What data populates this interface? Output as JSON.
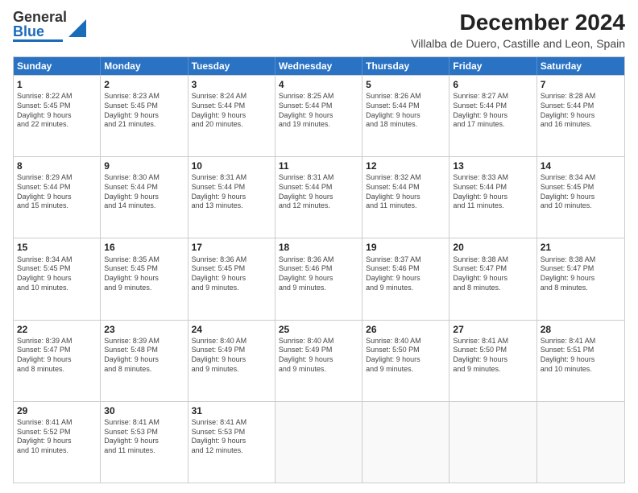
{
  "header": {
    "logo_general": "General",
    "logo_blue": "Blue",
    "title": "December 2024",
    "subtitle": "Villalba de Duero, Castille and Leon, Spain"
  },
  "days_of_week": [
    "Sunday",
    "Monday",
    "Tuesday",
    "Wednesday",
    "Thursday",
    "Friday",
    "Saturday"
  ],
  "weeks": [
    [
      {
        "day": "1",
        "lines": [
          "Sunrise: 8:22 AM",
          "Sunset: 5:45 PM",
          "Daylight: 9 hours",
          "and 22 minutes."
        ]
      },
      {
        "day": "2",
        "lines": [
          "Sunrise: 8:23 AM",
          "Sunset: 5:45 PM",
          "Daylight: 9 hours",
          "and 21 minutes."
        ]
      },
      {
        "day": "3",
        "lines": [
          "Sunrise: 8:24 AM",
          "Sunset: 5:44 PM",
          "Daylight: 9 hours",
          "and 20 minutes."
        ]
      },
      {
        "day": "4",
        "lines": [
          "Sunrise: 8:25 AM",
          "Sunset: 5:44 PM",
          "Daylight: 9 hours",
          "and 19 minutes."
        ]
      },
      {
        "day": "5",
        "lines": [
          "Sunrise: 8:26 AM",
          "Sunset: 5:44 PM",
          "Daylight: 9 hours",
          "and 18 minutes."
        ]
      },
      {
        "day": "6",
        "lines": [
          "Sunrise: 8:27 AM",
          "Sunset: 5:44 PM",
          "Daylight: 9 hours",
          "and 17 minutes."
        ]
      },
      {
        "day": "7",
        "lines": [
          "Sunrise: 8:28 AM",
          "Sunset: 5:44 PM",
          "Daylight: 9 hours",
          "and 16 minutes."
        ]
      }
    ],
    [
      {
        "day": "8",
        "lines": [
          "Sunrise: 8:29 AM",
          "Sunset: 5:44 PM",
          "Daylight: 9 hours",
          "and 15 minutes."
        ]
      },
      {
        "day": "9",
        "lines": [
          "Sunrise: 8:30 AM",
          "Sunset: 5:44 PM",
          "Daylight: 9 hours",
          "and 14 minutes."
        ]
      },
      {
        "day": "10",
        "lines": [
          "Sunrise: 8:31 AM",
          "Sunset: 5:44 PM",
          "Daylight: 9 hours",
          "and 13 minutes."
        ]
      },
      {
        "day": "11",
        "lines": [
          "Sunrise: 8:31 AM",
          "Sunset: 5:44 PM",
          "Daylight: 9 hours",
          "and 12 minutes."
        ]
      },
      {
        "day": "12",
        "lines": [
          "Sunrise: 8:32 AM",
          "Sunset: 5:44 PM",
          "Daylight: 9 hours",
          "and 11 minutes."
        ]
      },
      {
        "day": "13",
        "lines": [
          "Sunrise: 8:33 AM",
          "Sunset: 5:44 PM",
          "Daylight: 9 hours",
          "and 11 minutes."
        ]
      },
      {
        "day": "14",
        "lines": [
          "Sunrise: 8:34 AM",
          "Sunset: 5:45 PM",
          "Daylight: 9 hours",
          "and 10 minutes."
        ]
      }
    ],
    [
      {
        "day": "15",
        "lines": [
          "Sunrise: 8:34 AM",
          "Sunset: 5:45 PM",
          "Daylight: 9 hours",
          "and 10 minutes."
        ]
      },
      {
        "day": "16",
        "lines": [
          "Sunrise: 8:35 AM",
          "Sunset: 5:45 PM",
          "Daylight: 9 hours",
          "and 9 minutes."
        ]
      },
      {
        "day": "17",
        "lines": [
          "Sunrise: 8:36 AM",
          "Sunset: 5:45 PM",
          "Daylight: 9 hours",
          "and 9 minutes."
        ]
      },
      {
        "day": "18",
        "lines": [
          "Sunrise: 8:36 AM",
          "Sunset: 5:46 PM",
          "Daylight: 9 hours",
          "and 9 minutes."
        ]
      },
      {
        "day": "19",
        "lines": [
          "Sunrise: 8:37 AM",
          "Sunset: 5:46 PM",
          "Daylight: 9 hours",
          "and 9 minutes."
        ]
      },
      {
        "day": "20",
        "lines": [
          "Sunrise: 8:38 AM",
          "Sunset: 5:47 PM",
          "Daylight: 9 hours",
          "and 8 minutes."
        ]
      },
      {
        "day": "21",
        "lines": [
          "Sunrise: 8:38 AM",
          "Sunset: 5:47 PM",
          "Daylight: 9 hours",
          "and 8 minutes."
        ]
      }
    ],
    [
      {
        "day": "22",
        "lines": [
          "Sunrise: 8:39 AM",
          "Sunset: 5:47 PM",
          "Daylight: 9 hours",
          "and 8 minutes."
        ]
      },
      {
        "day": "23",
        "lines": [
          "Sunrise: 8:39 AM",
          "Sunset: 5:48 PM",
          "Daylight: 9 hours",
          "and 8 minutes."
        ]
      },
      {
        "day": "24",
        "lines": [
          "Sunrise: 8:40 AM",
          "Sunset: 5:49 PM",
          "Daylight: 9 hours",
          "and 9 minutes."
        ]
      },
      {
        "day": "25",
        "lines": [
          "Sunrise: 8:40 AM",
          "Sunset: 5:49 PM",
          "Daylight: 9 hours",
          "and 9 minutes."
        ]
      },
      {
        "day": "26",
        "lines": [
          "Sunrise: 8:40 AM",
          "Sunset: 5:50 PM",
          "Daylight: 9 hours",
          "and 9 minutes."
        ]
      },
      {
        "day": "27",
        "lines": [
          "Sunrise: 8:41 AM",
          "Sunset: 5:50 PM",
          "Daylight: 9 hours",
          "and 9 minutes."
        ]
      },
      {
        "day": "28",
        "lines": [
          "Sunrise: 8:41 AM",
          "Sunset: 5:51 PM",
          "Daylight: 9 hours",
          "and 10 minutes."
        ]
      }
    ],
    [
      {
        "day": "29",
        "lines": [
          "Sunrise: 8:41 AM",
          "Sunset: 5:52 PM",
          "Daylight: 9 hours",
          "and 10 minutes."
        ]
      },
      {
        "day": "30",
        "lines": [
          "Sunrise: 8:41 AM",
          "Sunset: 5:53 PM",
          "Daylight: 9 hours",
          "and 11 minutes."
        ]
      },
      {
        "day": "31",
        "lines": [
          "Sunrise: 8:41 AM",
          "Sunset: 5:53 PM",
          "Daylight: 9 hours",
          "and 12 minutes."
        ]
      },
      {
        "day": "",
        "lines": []
      },
      {
        "day": "",
        "lines": []
      },
      {
        "day": "",
        "lines": []
      },
      {
        "day": "",
        "lines": []
      }
    ]
  ]
}
